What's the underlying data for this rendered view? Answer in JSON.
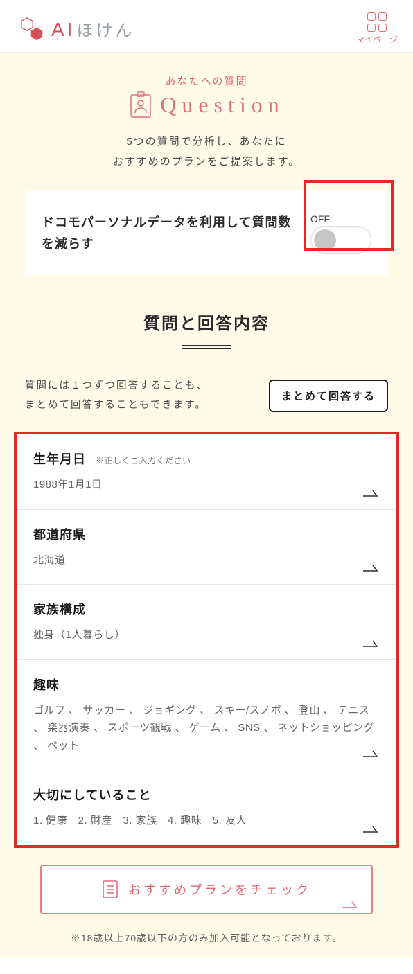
{
  "header": {
    "logo_ai": "AI",
    "logo_hoken": "ほけん",
    "mypage_label": "マイページ"
  },
  "question_header": {
    "subtitle": "あなたへの質問",
    "title": "Question",
    "description_line1": "5つの質問で分析し、あなたに",
    "description_line2": "おすすめのプランをご提案します。"
  },
  "toggle": {
    "text": "ドコモパーソナルデータを利用して質問数を減らす",
    "state_label": "OFF"
  },
  "section_title": "質問と回答内容",
  "info_row": {
    "line1": "質問には１つずつ回答することも、",
    "line2": "まとめて回答することもできます。",
    "button": "まとめて回答する"
  },
  "questions": [
    {
      "label": "生年月日",
      "hint": "※正しくご入力ください",
      "value": "1988年1月1日"
    },
    {
      "label": "都道府県",
      "hint": "",
      "value": "北海道"
    },
    {
      "label": "家族構成",
      "hint": "",
      "value": "独身（1人暮らし）"
    },
    {
      "label": "趣味",
      "hint": "",
      "value": "ゴルフ 、 サッカー 、 ジョギング 、 スキー/スノボ 、 登山 、 テニス 、 楽器演奏 、 スポーツ観戦 、 ゲーム 、 SNS 、 ネットショッピング 、 ペット"
    },
    {
      "label": "大切にしていること",
      "hint": "",
      "value": "1. 健康　2. 財産　3. 家族　4. 趣味　5. 友人"
    }
  ],
  "check_button": "おすすめプランをチェック",
  "footer_note": "※18歳以上70歳以下の方のみ加入可能となっております。"
}
